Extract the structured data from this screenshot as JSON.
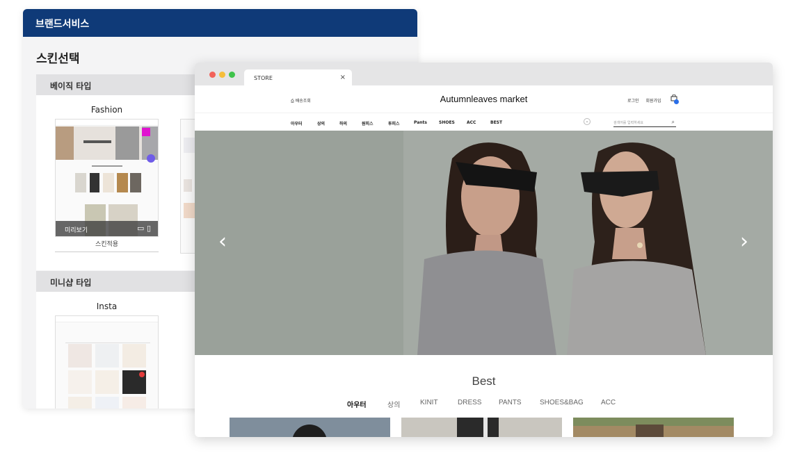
{
  "panel": {
    "header_title": "브랜드서비스",
    "title": "스킨선택",
    "sections": [
      {
        "label": "베이직 타입",
        "skin_name": "Fashion",
        "preview_label": "미리보기",
        "apply_label": "스킨적용"
      },
      {
        "label": "미니샵 타입",
        "skin_name": "Insta"
      }
    ]
  },
  "browser": {
    "tab_title": "STORE",
    "tab_close": "×",
    "window_dots": {
      "red": "#f2625a",
      "yellow": "#f6be3b",
      "green": "#3fc34b"
    }
  },
  "site": {
    "logo": "Autumnleaves market",
    "delivery": "배송조회",
    "login": "로그인",
    "signup": "회원가입",
    "nav": [
      "아우터",
      "상의",
      "하의",
      "원피스",
      "투피스",
      "Pants",
      "SHOES",
      "ACC",
      "BEST"
    ],
    "more_icon": "⌄",
    "search_placeholder": "검색어를 입력하세요",
    "cart_badge_color": "#2a6ee8"
  },
  "hero": {
    "prev": "‹",
    "next": "›"
  },
  "best": {
    "title": "Best",
    "tabs": [
      "아우터",
      "상의",
      "KINIT",
      "DRESS",
      "PANTS",
      "SHOES&BAG",
      "ACC"
    ],
    "active_tab": "아우터"
  },
  "colors": {
    "panel_header": "#0f3a78",
    "hero_bg": "#9aa19a"
  }
}
